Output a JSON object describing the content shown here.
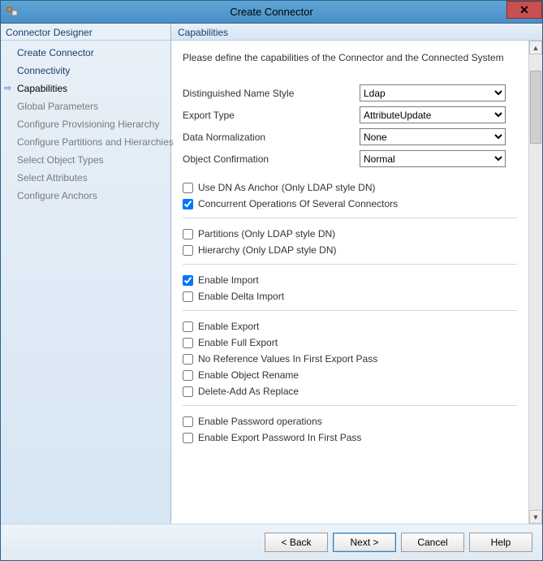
{
  "window": {
    "title": "Create Connector"
  },
  "sidebar": {
    "header": "Connector Designer",
    "items": [
      {
        "label": "Create Connector",
        "state": "done"
      },
      {
        "label": "Connectivity",
        "state": "done"
      },
      {
        "label": "Capabilities",
        "state": "current"
      },
      {
        "label": "Global Parameters",
        "state": "disabled"
      },
      {
        "label": "Configure Provisioning Hierarchy",
        "state": "disabled"
      },
      {
        "label": "Configure Partitions and Hierarchies",
        "state": "disabled"
      },
      {
        "label": "Select Object Types",
        "state": "disabled"
      },
      {
        "label": "Select Attributes",
        "state": "disabled"
      },
      {
        "label": "Configure Anchors",
        "state": "disabled"
      }
    ]
  },
  "main": {
    "header": "Capabilities",
    "instructions": "Please define the capabilities of the Connector and the Connected System",
    "fields": {
      "dn_style": {
        "label": "Distinguished Name Style",
        "value": "Ldap"
      },
      "export_type": {
        "label": "Export Type",
        "value": "AttributeUpdate"
      },
      "data_norm": {
        "label": "Data Normalization",
        "value": "None"
      },
      "obj_confirm": {
        "label": "Object Confirmation",
        "value": "Normal"
      }
    },
    "checks": {
      "use_dn_anchor": {
        "label": "Use DN As Anchor (Only LDAP style DN)",
        "checked": false
      },
      "concurrent_ops": {
        "label": "Concurrent Operations Of Several Connectors",
        "checked": true
      },
      "partitions": {
        "label": "Partitions (Only LDAP style DN)",
        "checked": false
      },
      "hierarchy": {
        "label": "Hierarchy (Only LDAP style DN)",
        "checked": false
      },
      "enable_import": {
        "label": "Enable Import",
        "checked": true
      },
      "enable_delta_import": {
        "label": "Enable Delta Import",
        "checked": false
      },
      "enable_export": {
        "label": "Enable Export",
        "checked": false
      },
      "enable_full_export": {
        "label": "Enable Full Export",
        "checked": false
      },
      "no_ref_first_export": {
        "label": "No Reference Values In First Export Pass",
        "checked": false
      },
      "enable_obj_rename": {
        "label": "Enable Object Rename",
        "checked": false
      },
      "delete_add_replace": {
        "label": "Delete-Add As Replace",
        "checked": false
      },
      "enable_pwd_ops": {
        "label": "Enable Password operations",
        "checked": false
      },
      "enable_export_pwd_first": {
        "label": "Enable Export Password In First Pass",
        "checked": false
      }
    }
  },
  "footer": {
    "back": "<  Back",
    "next": "Next  >",
    "cancel": "Cancel",
    "help": "Help"
  }
}
